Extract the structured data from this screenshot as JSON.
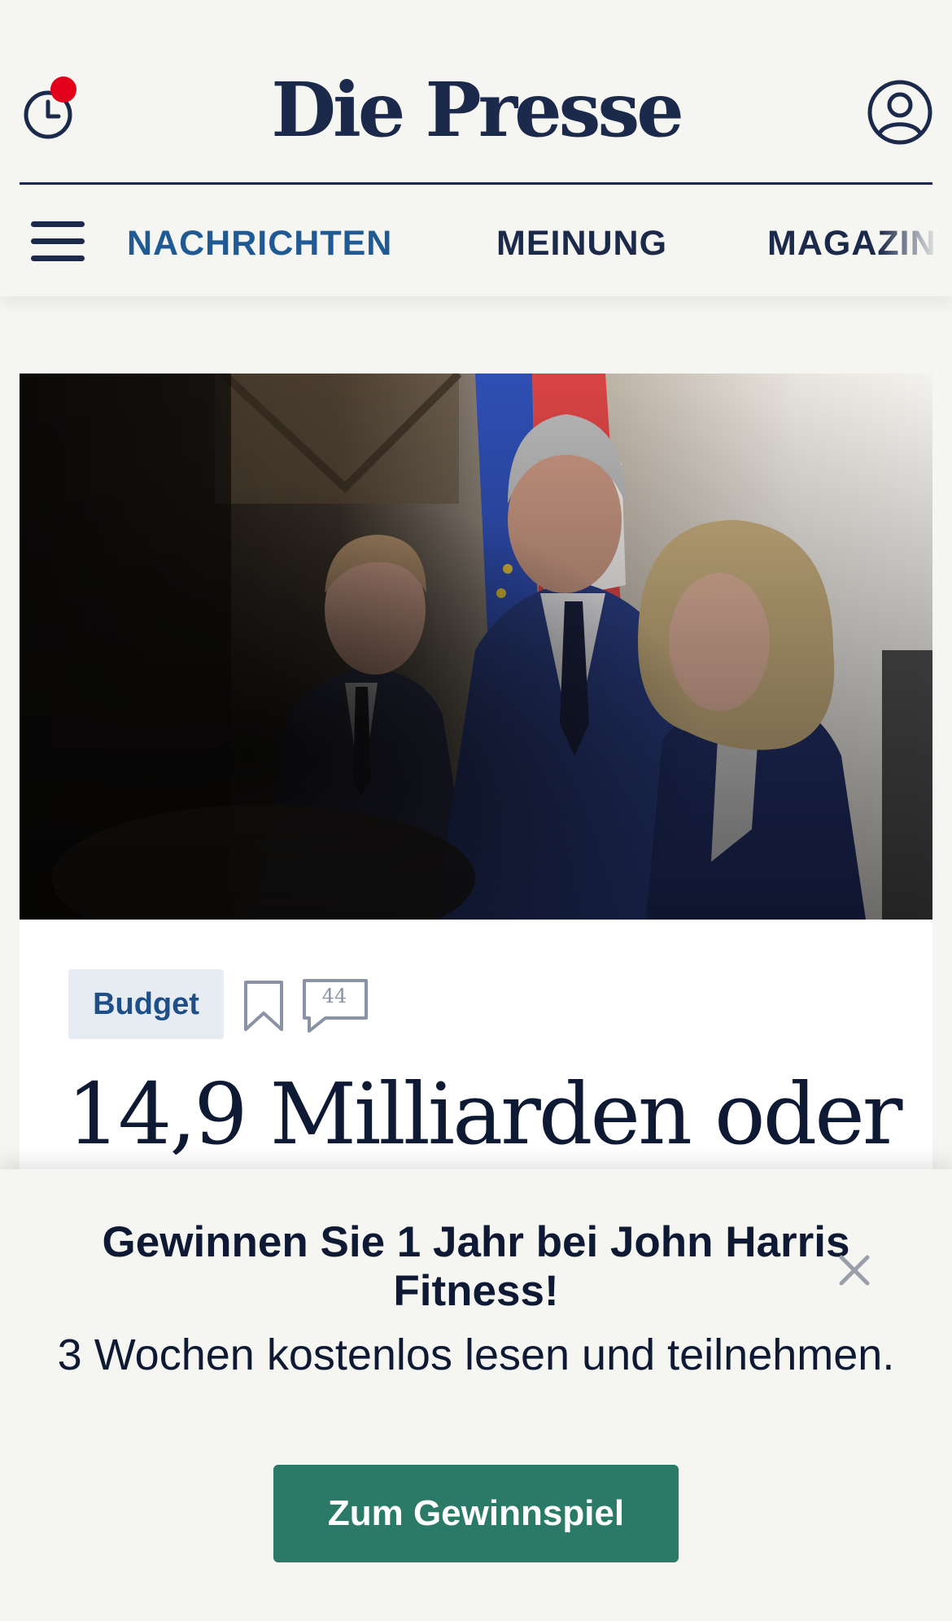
{
  "header": {
    "logo": "Die Presse",
    "history_icon": "history-clock-icon",
    "account_icon": "user-account-icon",
    "notification_color": "#e3001b"
  },
  "nav": {
    "menu_icon": "hamburger-menu-icon",
    "items": [
      {
        "label": "NACHRICHTEN",
        "active": true
      },
      {
        "label": "MEINUNG",
        "active": false
      },
      {
        "label": "MAGAZIN",
        "active": false
      }
    ]
  },
  "article": {
    "tag": "Budget",
    "bookmark_icon": "bookmark-icon",
    "comment_icon": "comment-bubble-icon",
    "comment_count": "44",
    "headline": "14,9 Milliarden oder"
  },
  "promo": {
    "title": "Gewinnen Sie 1 Jahr bei John Harris Fitness!",
    "subtitle": "3 Wochen kostenlos lesen und teilnehmen.",
    "cta_label": "Zum Gewinnspiel",
    "close_icon": "close-icon",
    "cta_color": "#2a7a67"
  },
  "colors": {
    "background": "#f5f5f1",
    "brand_navy": "#1b2a4a",
    "link_blue": "#1f5a94"
  }
}
